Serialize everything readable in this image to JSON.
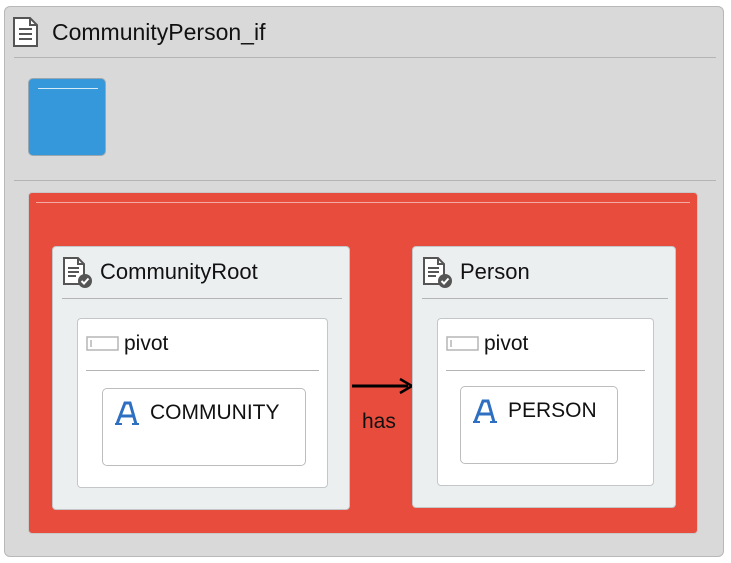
{
  "container": {
    "title": "CommunityPerson_if",
    "colors": {
      "background": "#d9d9d9",
      "accent_block": "#3498db",
      "region": "#e74c3c"
    }
  },
  "entities": [
    {
      "title": "CommunityRoot",
      "icon": "document-check-icon",
      "pivot": {
        "label": "pivot",
        "icon": "pivot-field-icon",
        "table": {
          "label": "COMMUNITY",
          "icon": "table-a-icon"
        }
      }
    },
    {
      "title": "Person",
      "icon": "document-check-icon",
      "pivot": {
        "label": "pivot",
        "icon": "pivot-field-icon",
        "table": {
          "label": "PERSON",
          "icon": "table-a-icon"
        }
      }
    }
  ],
  "relation": {
    "label": "has"
  }
}
